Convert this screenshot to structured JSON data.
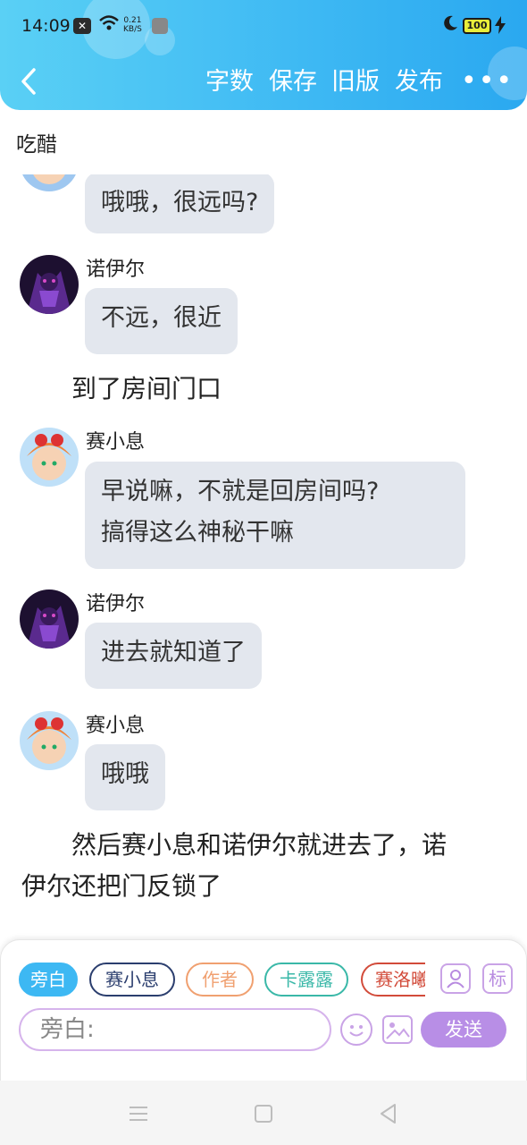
{
  "status_bar": {
    "time": "14:09",
    "notif_icon": "x-icon",
    "net_speed_value": "0.21",
    "net_speed_unit": "KB/S",
    "battery": "100"
  },
  "toolbar": {
    "back_icon": "chevron-left-icon",
    "word_count": "字数",
    "save": "保存",
    "old_version": "旧版",
    "publish": "发布",
    "more": "•••"
  },
  "chapter": {
    "title": "吃醋"
  },
  "messages": [
    {
      "type": "dialog",
      "speaker": "",
      "text": "哦哦，很远吗?"
    },
    {
      "type": "dialog",
      "speaker": "诺伊尔",
      "text": "不远，很近"
    },
    {
      "type": "narration",
      "text": "到了房间门口"
    },
    {
      "type": "dialog",
      "speaker": "赛小息",
      "line1": "早说嘛，不就是回房间吗?",
      "line2": "搞得这么神秘干嘛"
    },
    {
      "type": "dialog",
      "speaker": "诺伊尔",
      "text": "进去就知道了"
    },
    {
      "type": "dialog",
      "speaker": "赛小息",
      "text": "哦哦"
    },
    {
      "type": "narration",
      "line1": "然后赛小息和诺伊尔就进去了，诺",
      "line2": "伊尔还把门反锁了"
    },
    {
      "type": "narration",
      "text": "——————————"
    }
  ],
  "roles": [
    {
      "label": "旁白",
      "color": "#3db8f3",
      "active": true
    },
    {
      "label": "赛小息",
      "color": "#2b3e6e",
      "active": false
    },
    {
      "label": "作者",
      "color": "#f0a070",
      "active": false
    },
    {
      "label": "卡露露",
      "color": "#3ab8a8",
      "active": false
    },
    {
      "label": "赛洛曦",
      "color": "#d24b3a",
      "active": false
    }
  ],
  "tools": {
    "role_manage_icon": "person-icon",
    "mark_label": "标"
  },
  "input": {
    "placeholder": "旁白:"
  },
  "send_label": "发送",
  "accent_color": "#3db8f3",
  "send_color": "#b88ee6"
}
